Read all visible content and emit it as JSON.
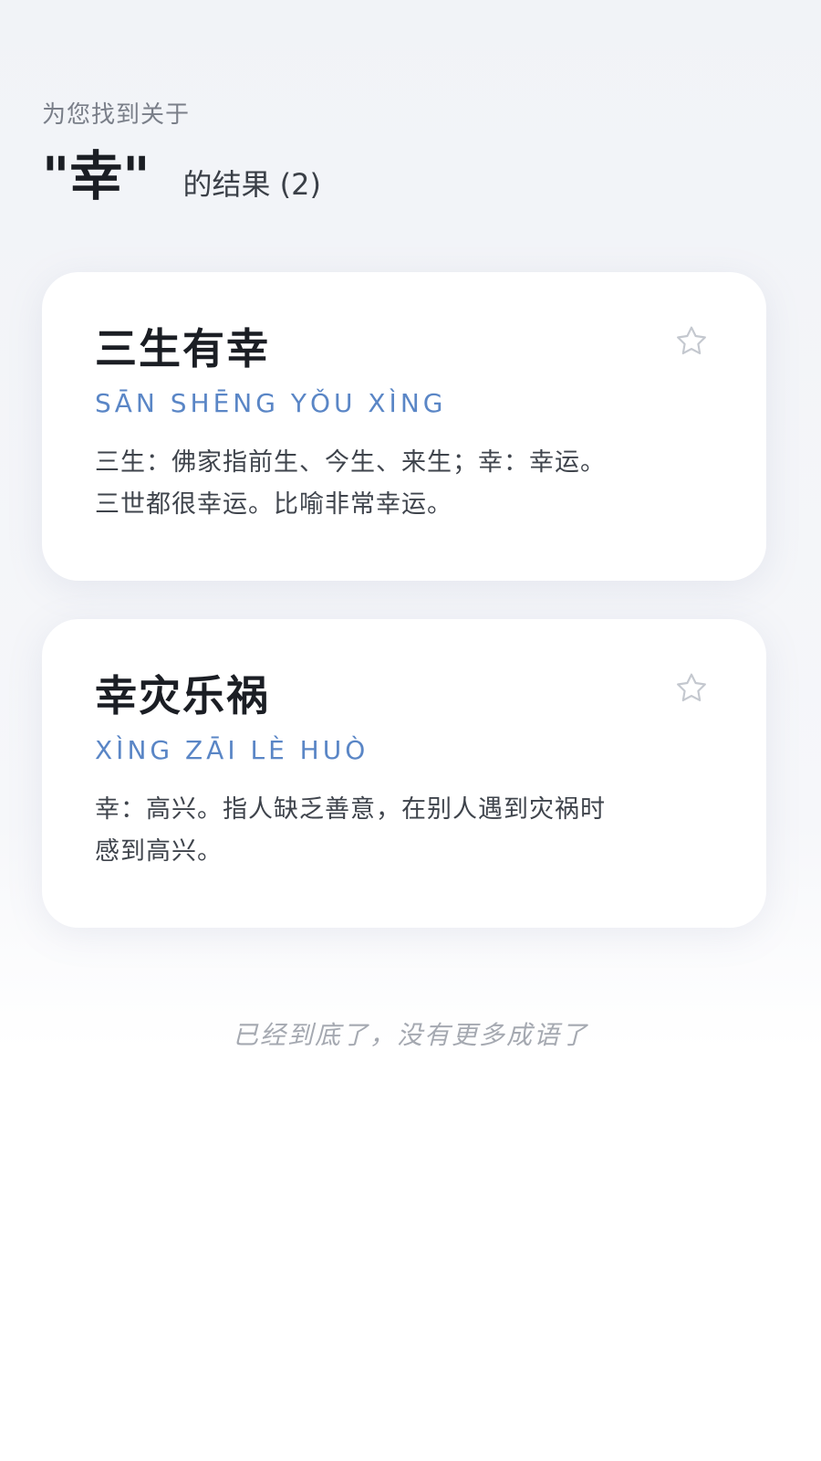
{
  "header": {
    "subtitle": "为您找到关于",
    "query": "\"幸\"",
    "suffix": "的结果 (2)"
  },
  "results": [
    {
      "title": "三生有幸",
      "pinyin": "SĀN SHĒNG YǑU XÌNG",
      "description": "三生：佛家指前生、今生、来生；幸：幸运。三世都很幸运。比喻非常幸运。",
      "favorite_icon": "star-outline-icon"
    },
    {
      "title": "幸灾乐祸",
      "pinyin": "XÌNG ZĀI LÈ HUÒ",
      "description": "幸：高兴。指人缺乏善意，在别人遇到灾祸时感到高兴。",
      "favorite_icon": "star-outline-icon"
    }
  ],
  "footer": {
    "end_note": "已经到底了，没有更多成语了"
  },
  "colors": {
    "pinyin": "#5a86c6",
    "title": "#1b1e24",
    "muted": "#a5a9b1"
  }
}
